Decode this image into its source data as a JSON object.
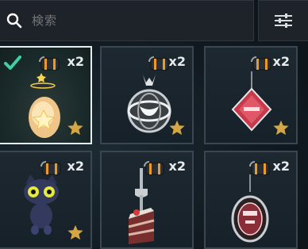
{
  "search": {
    "placeholder": "検索",
    "icon": "search-icon"
  },
  "filter": {
    "icon": "sliders-icon"
  },
  "colors": {
    "star": "#d4a646",
    "check": "#3fd0a3",
    "selected_border": "#e6ebef"
  },
  "items": [
    {
      "name": "glowing-egg-charm",
      "quantity": "x2",
      "favorite": true,
      "selected": true
    },
    {
      "name": "metal-orb-charm",
      "quantity": "x2",
      "favorite": true,
      "selected": false
    },
    {
      "name": "red-diamond-charm",
      "quantity": "x2",
      "favorite": true,
      "selected": false
    },
    {
      "name": "black-cat-charm",
      "quantity": "x2",
      "favorite": true,
      "selected": false
    },
    {
      "name": "cake-fork-charm",
      "quantity": "x2",
      "favorite": false,
      "selected": false
    },
    {
      "name": "round-badge-charm",
      "quantity": "x2",
      "favorite": false,
      "selected": false
    }
  ]
}
